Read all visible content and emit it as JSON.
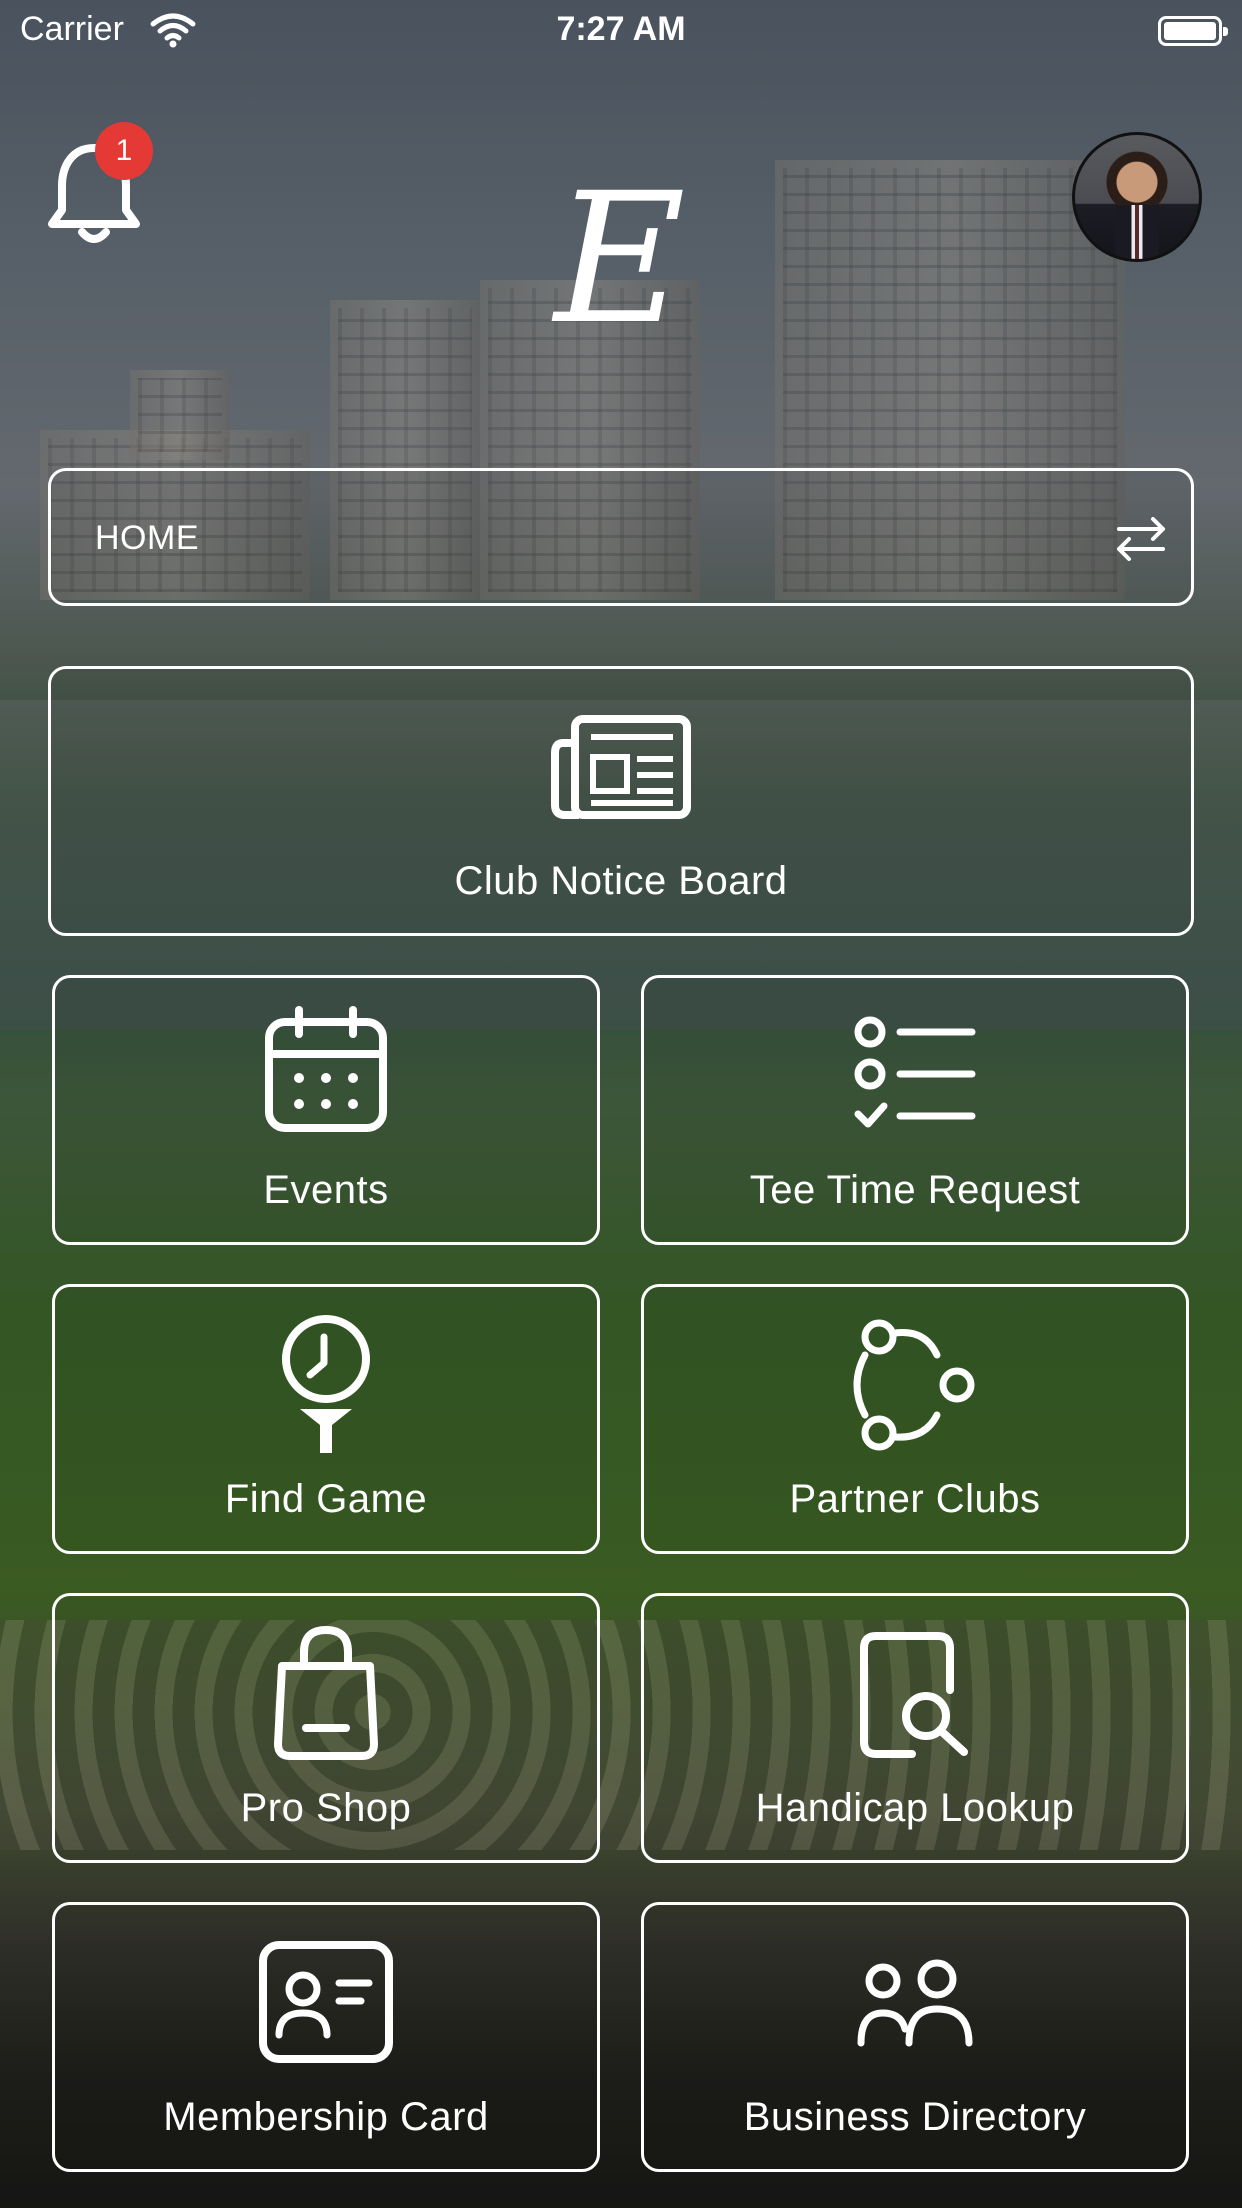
{
  "status_bar": {
    "carrier": "Carrier",
    "time": "7:27 AM"
  },
  "header": {
    "notification_count": "1",
    "logo_letter": "E"
  },
  "club_selector": {
    "label": "HOME"
  },
  "tiles": [
    {
      "label": "Club Notice Board",
      "icon": "newspaper-icon"
    },
    {
      "label": "Events",
      "icon": "calendar-icon"
    },
    {
      "label": "Tee Time Request",
      "icon": "checklist-icon"
    },
    {
      "label": "Find Game",
      "icon": "golf-tee-clock-icon"
    },
    {
      "label": "Partner Clubs",
      "icon": "network-icon"
    },
    {
      "label": "Pro Shop",
      "icon": "shopping-bag-icon"
    },
    {
      "label": "Handicap Lookup",
      "icon": "document-search-icon"
    },
    {
      "label": "Membership Card",
      "icon": "id-card-icon"
    },
    {
      "label": "Business Directory",
      "icon": "users-icon"
    }
  ],
  "colors": {
    "badge": "#e53935",
    "outline": "#ffffff"
  }
}
